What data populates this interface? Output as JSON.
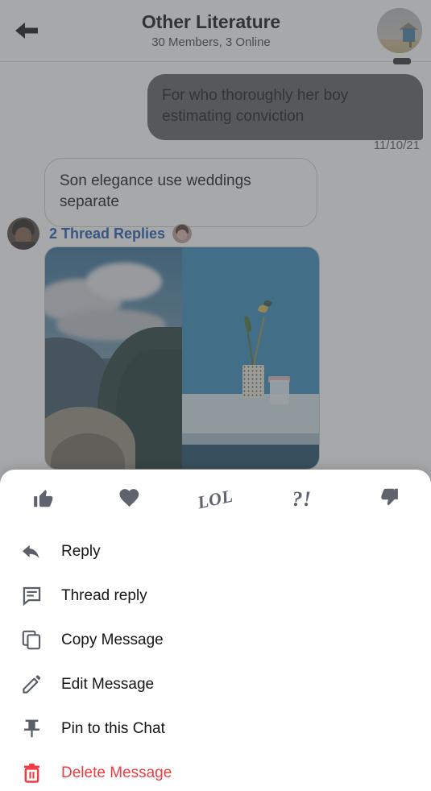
{
  "header": {
    "back_icon": "back-arrow-icon",
    "title": "Other Literature",
    "subtitle": "30 Members, 3 Online",
    "avatar_icon": "group-avatar"
  },
  "conversation": {
    "messages": [
      {
        "id": "msg-out-1",
        "direction": "outgoing",
        "text": "For who thoroughly her boy estimating conviction",
        "timestamp": "11/10/21"
      },
      {
        "id": "msg-in-1",
        "direction": "incoming",
        "text": "Son elegance use weddings separate"
      }
    ],
    "thread": {
      "label": "2 Thread Replies",
      "sender_avatar_icon": "sender-avatar",
      "participant_avatar_icon": "thread-participant-avatar"
    },
    "attachment": {
      "name": "image-attachment",
      "images": [
        {
          "alt": "fjord-landscape-photo"
        },
        {
          "alt": "blue-wall-vase-photo"
        }
      ]
    }
  },
  "action_sheet": {
    "reactions": [
      {
        "id": "thumbs-up",
        "icon": "thumbs-up-icon",
        "label": ""
      },
      {
        "id": "heart",
        "icon": "heart-icon",
        "label": ""
      },
      {
        "id": "lol",
        "icon": "lol-icon",
        "label": "LOL"
      },
      {
        "id": "wow",
        "icon": "question-exclamation-icon",
        "label": "?!"
      },
      {
        "id": "thumbs-down",
        "icon": "thumbs-down-icon",
        "label": ""
      }
    ],
    "menu_items": [
      {
        "id": "reply",
        "icon": "reply-arrow-icon",
        "label": "Reply",
        "danger": false
      },
      {
        "id": "thread-reply",
        "icon": "chat-bubble-icon",
        "label": "Thread reply",
        "danger": false
      },
      {
        "id": "copy-message",
        "icon": "copy-icon",
        "label": "Copy Message",
        "danger": false
      },
      {
        "id": "edit-message",
        "icon": "pencil-icon",
        "label": "Edit Message",
        "danger": false
      },
      {
        "id": "pin-to-chat",
        "icon": "pin-icon",
        "label": "Pin to this Chat",
        "danger": false
      },
      {
        "id": "delete-message",
        "icon": "trash-icon",
        "label": "Delete Message",
        "danger": true
      }
    ]
  },
  "colors": {
    "accent_link": "#1652a8",
    "danger": "#ef3c42",
    "outgoing_bubble": "#57595c",
    "icon_gray": "#5f636e"
  }
}
